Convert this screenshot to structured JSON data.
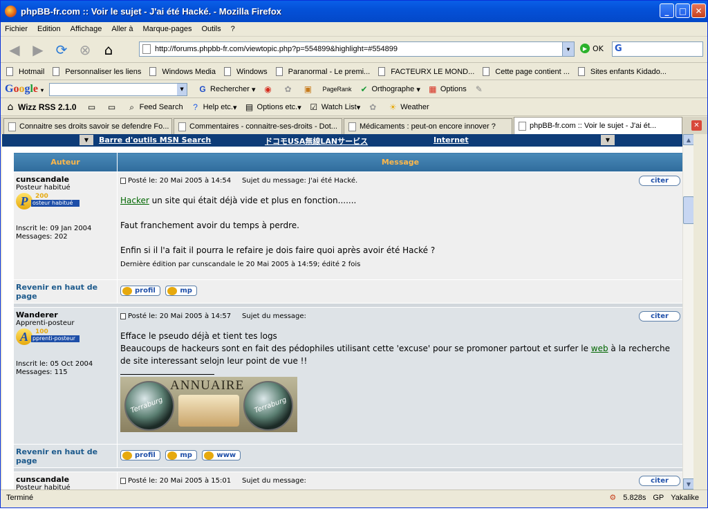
{
  "window": {
    "title": "phpBB-fr.com :: Voir le sujet - J'ai été Hacké. - Mozilla Firefox"
  },
  "menu": [
    "Fichier",
    "Edition",
    "Affichage",
    "Aller à",
    "Marque-pages",
    "Outils",
    "?"
  ],
  "nav": {
    "url": "http://forums.phpbb-fr.com/viewtopic.php?p=554899&highlight=#554899",
    "go_label": "OK",
    "search_placeholder": ""
  },
  "bookmarks": [
    "Hotmail",
    "Personnaliser les liens",
    "Windows Media",
    "Windows",
    "Paranormal - Le premi...",
    "FACTEURX LE MOND...",
    "Cette page contient ...",
    "Sites enfants Kidado..."
  ],
  "google_toolbar": {
    "logo": "Google",
    "search_label": "Rechercher",
    "pagerank": "PageRank",
    "spell": "Orthographe",
    "options": "Options"
  },
  "wizz_toolbar": {
    "title": "Wizz RSS 2.1.0",
    "feed_search": "Feed Search",
    "help": "Help etc.",
    "options": "Options etc.",
    "watch": "Watch List",
    "weather": "Weather"
  },
  "tabs": [
    {
      "label": "Connaitre ses droits savoir se defendre Fo..."
    },
    {
      "label": "Commentaires - connaitre-ses-droits - Dot..."
    },
    {
      "label": "Médicaments : peut-on encore innover ?"
    },
    {
      "label": "phpBB-fr.com :: Voir le sujet - J'ai ét..."
    }
  ],
  "msn": {
    "link1": "Barre d'outils MSN Search",
    "link2": "ドコモUSA無線LANサービス",
    "link3": "Internet"
  },
  "forum": {
    "col_author": "Auteur",
    "col_message": "Message",
    "back_to_top": "Revenir en haut de page",
    "posts": [
      {
        "author": "cunscandale",
        "rank": "Posteur habitué",
        "rank_num": "200",
        "rank_bar": "osteur habitué",
        "rank_letter": "P",
        "joined": "Inscrit le: 09 Jan 2004",
        "messages": "Messages: 202",
        "posted": "Posté le: 20 Mai 2005 à 14:54",
        "subject": "Sujet du message: J'ai été Hacké.",
        "link_word": "Hacker",
        "line1": " un site qui était déjà vide et plus en fonction.......",
        "line2": "Faut franchement avoir du temps à perdre.",
        "line3": "Enfin si il l'a fait il pourra le refaire je dois faire quoi après avoir été Hacké ?",
        "edit": "Dernière édition par cunscandale le 20 Mai 2005 à 14:59; édité 2 fois"
      },
      {
        "author": "Wanderer",
        "rank": "Apprenti-posteur",
        "rank_num": "100",
        "rank_bar": "pprenti-posteur",
        "rank_letter": "A",
        "joined": "Inscrit le: 05 Oct 2004",
        "messages": "Messages: 115",
        "posted": "Posté le: 20 Mai 2005 à 14:57",
        "subject": "Sujet du message:",
        "line1": "Efface le pseudo déjà et tient tes logs",
        "line2a": "Beaucoups de hackeurs sont en fait des pédophiles utilisant cette 'excuse' pour se promoner partout et surfer le ",
        "link_word": "web",
        "line2b": " à la recherche de site interessant selojn leur point de vue !!",
        "banner_text": "ANNUAIRE",
        "banner_sub": "Terraburg"
      },
      {
        "author": "cunscandale",
        "rank": "Posteur habitué",
        "posted": "Posté le: 20 Mai 2005 à 15:01",
        "subject": "Sujet du message:"
      }
    ],
    "buttons": {
      "quote": "citer",
      "profile": "profil",
      "pm": "mp",
      "www": "www"
    }
  },
  "status": {
    "text": "Terminé",
    "time": "5.828s",
    "gp": "GP",
    "yak": "Yakalike"
  }
}
